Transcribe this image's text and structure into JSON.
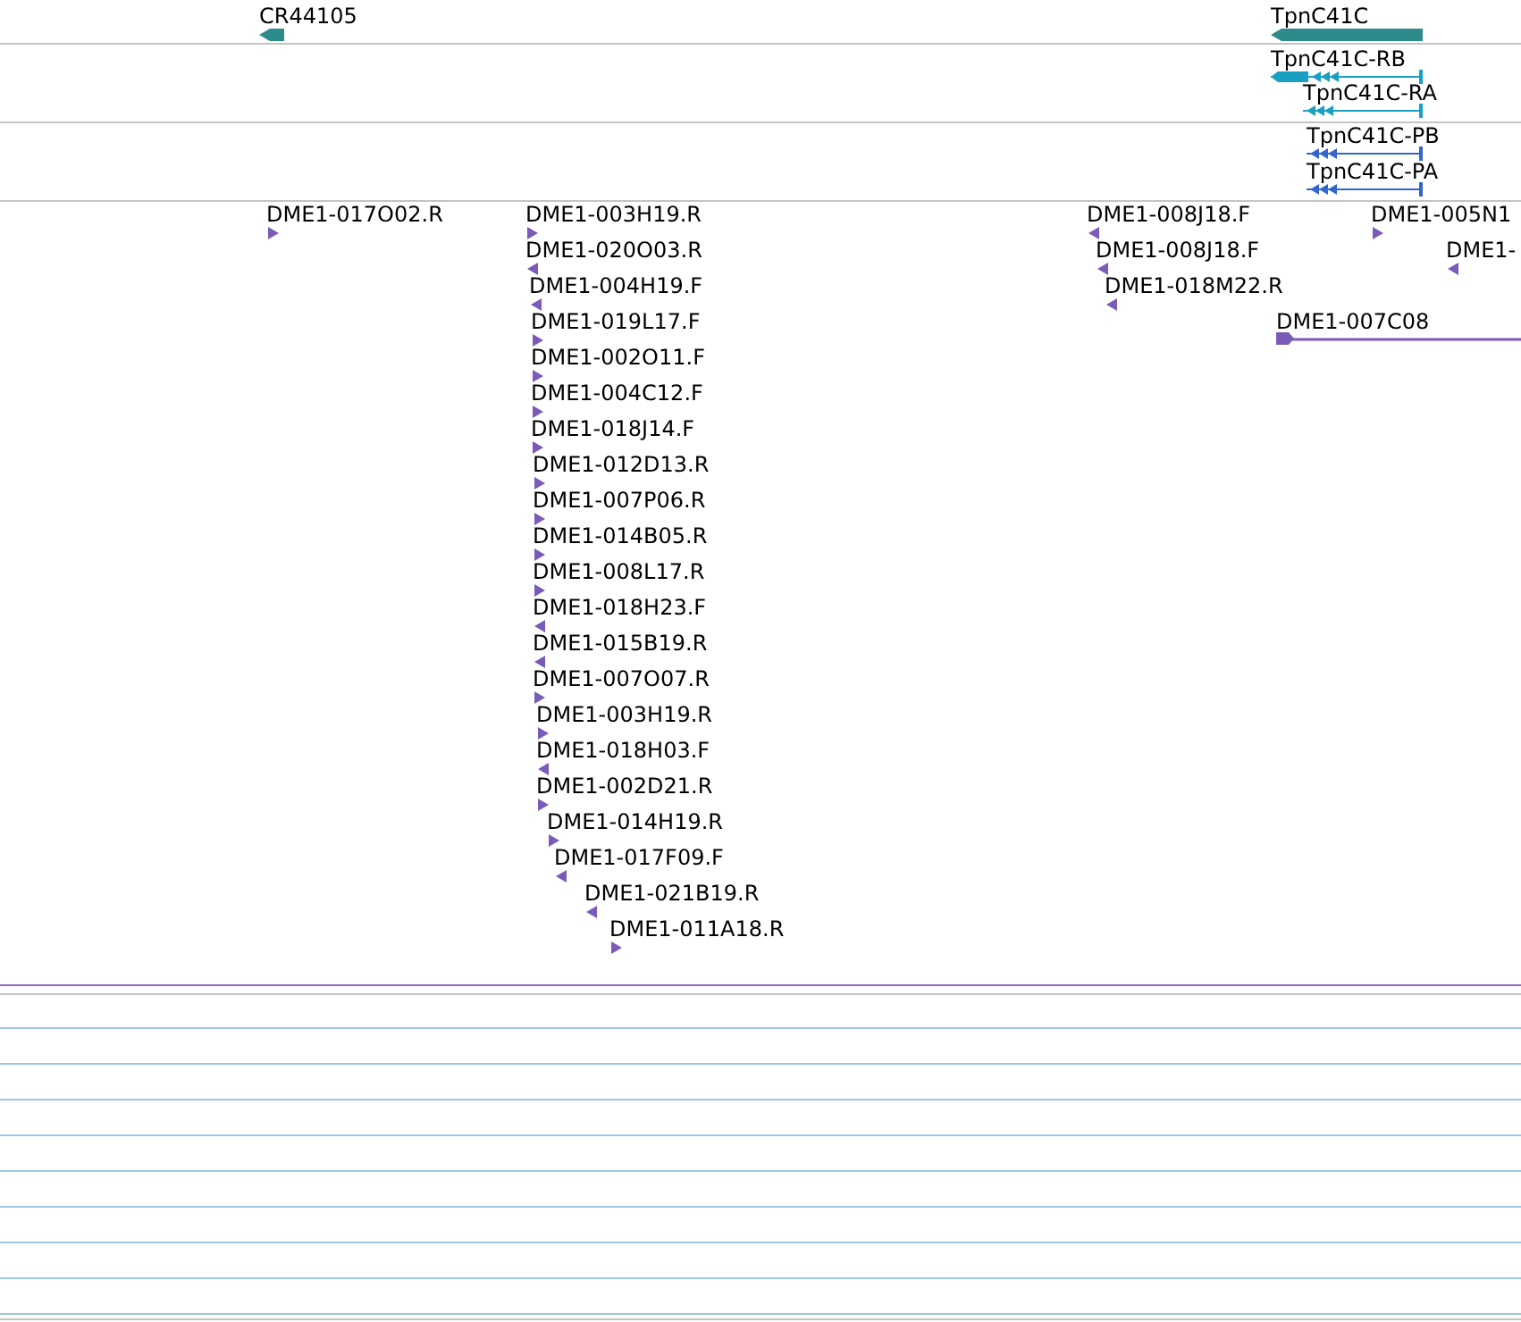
{
  "tracks": [
    {
      "kind": "gene",
      "color": "#2e8b8b",
      "features": [
        {
          "label": "CR44105",
          "reverse": true
        },
        {
          "label": "TpnC41C",
          "reverse": true
        }
      ]
    },
    {
      "kind": "transcript",
      "color": "#1a9fc2",
      "features": [
        {
          "label": "TpnC41C-RB",
          "reverse": true
        },
        {
          "label": "TpnC41C-RA",
          "reverse": true
        }
      ]
    },
    {
      "kind": "transcript",
      "color": "#3366cc",
      "features": [
        {
          "label": "TpnC41C-PB",
          "reverse": true
        },
        {
          "label": "TpnC41C-PA",
          "reverse": true
        }
      ]
    },
    {
      "kind": "est",
      "color": "#7a5cb8",
      "features": [
        {
          "label": "DME1-017O02.R",
          "reverse": false
        },
        {
          "label": "DME1-003H19.R",
          "reverse": false
        },
        {
          "label": "DME1-020O03.R",
          "reverse": true
        },
        {
          "label": "DME1-004H19.F",
          "reverse": true
        },
        {
          "label": "DME1-019L17.F",
          "reverse": false
        },
        {
          "label": "DME1-002O11.F",
          "reverse": false
        },
        {
          "label": "DME1-004C12.F",
          "reverse": false
        },
        {
          "label": "DME1-018J14.F",
          "reverse": false
        },
        {
          "label": "DME1-012D13.R",
          "reverse": false
        },
        {
          "label": "DME1-007P06.R",
          "reverse": false
        },
        {
          "label": "DME1-014B05.R",
          "reverse": false
        },
        {
          "label": "DME1-008L17.R",
          "reverse": false
        },
        {
          "label": "DME1-018H23.F",
          "reverse": true
        },
        {
          "label": "DME1-015B19.R",
          "reverse": true
        },
        {
          "label": "DME1-007O07.R",
          "reverse": false
        },
        {
          "label": "DME1-003H19.R",
          "reverse": false
        },
        {
          "label": "DME1-018H03.F",
          "reverse": true
        },
        {
          "label": "DME1-002D21.R",
          "reverse": false
        },
        {
          "label": "DME1-014H19.R",
          "reverse": false
        },
        {
          "label": "DME1-017F09.F",
          "reverse": true
        },
        {
          "label": "DME1-021B19.R",
          "reverse": true
        },
        {
          "label": "DME1-011A18.R",
          "reverse": false
        },
        {
          "label": "DME1-008J18.F",
          "reverse": true
        },
        {
          "label": "DME1-008J18.F",
          "reverse": true
        },
        {
          "label": "DME1-018M22.R",
          "reverse": true
        },
        {
          "label": "DME1-005N1",
          "reverse": false
        },
        {
          "label": "DME1-",
          "reverse": true
        },
        {
          "label": "DME1-007C08",
          "reverse": false
        }
      ]
    }
  ]
}
